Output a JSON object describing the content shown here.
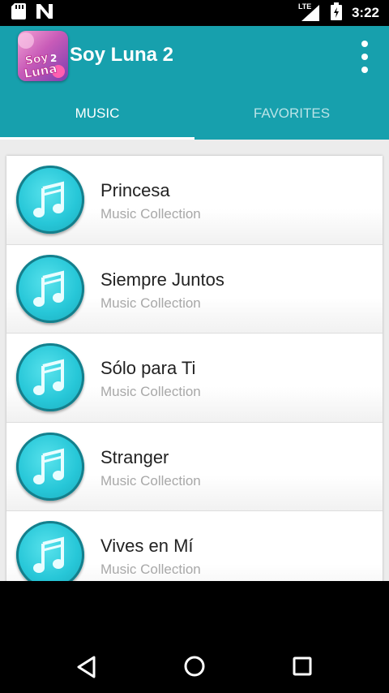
{
  "status_bar": {
    "time": "3:22",
    "network": "LTE",
    "icons": [
      "sd-card-icon",
      "notification-n-icon",
      "signal-icon",
      "battery-icon"
    ]
  },
  "app": {
    "title": "Soy Luna 2",
    "icon_text": "Soy Luna 2",
    "primary_color": "#17a0ad"
  },
  "tabs": [
    {
      "label": "MUSIC",
      "active": true
    },
    {
      "label": "FAVORITES",
      "active": false
    }
  ],
  "songs": [
    {
      "title": "Princesa",
      "subtitle": "Music Collection"
    },
    {
      "title": "Siempre Juntos",
      "subtitle": "Music Collection"
    },
    {
      "title": "Sólo para Ti",
      "subtitle": "Music Collection"
    },
    {
      "title": "Stranger",
      "subtitle": "Music Collection"
    },
    {
      "title": "Vives en Mí",
      "subtitle": "Music Collection"
    }
  ],
  "nav": [
    "back-icon",
    "home-icon",
    "recents-icon"
  ]
}
